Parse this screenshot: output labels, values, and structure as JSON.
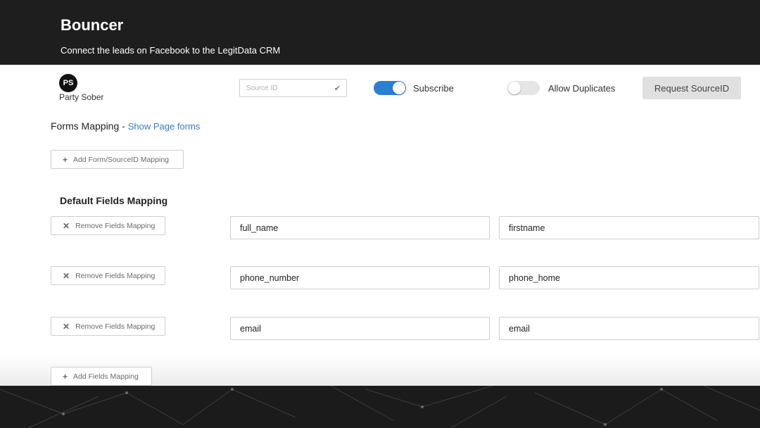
{
  "header": {
    "title": "Bouncer",
    "subtitle": "Connect the leads on Facebook to the LegitData CRM"
  },
  "page": {
    "avatar_initials": "PS",
    "name": "Party Sober",
    "source_placeholder": "Source ID",
    "subscribe": {
      "label": "Subscribe",
      "on": true
    },
    "allow_duplicates": {
      "label": "Allow Duplicates",
      "on": false
    },
    "request_button": "Request SourceID"
  },
  "forms_mapping": {
    "title": "Forms Mapping",
    "separator": "-",
    "show_link": "Show Page forms",
    "add_button": "Add Form/SourceID Mapping"
  },
  "default_fields": {
    "title": "Default Fields Mapping",
    "rows": [
      {
        "remove_label": "Remove Fields Mapping",
        "source": "full_name",
        "target": "firstname"
      },
      {
        "remove_label": "Remove Fields Mapping",
        "source": "phone_number",
        "target": "phone_home"
      },
      {
        "remove_label": "Remove Fields Mapping",
        "source": "email",
        "target": "email"
      }
    ],
    "add_button": "Add Fields Mapping"
  },
  "colors": {
    "header_bg": "#1e1e1e",
    "accent": "#2a7fd4",
    "link": "#3a7bbf"
  }
}
